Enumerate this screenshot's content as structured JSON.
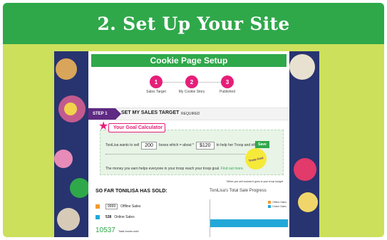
{
  "banner": {
    "title": "2. Set Up Your Site"
  },
  "cookie_page": {
    "header": "Cookie Page Setup",
    "steps": [
      {
        "number": "1",
        "label": "Sales Target"
      },
      {
        "number": "2",
        "label": "My Cookie Story"
      },
      {
        "number": "3",
        "label": "Published"
      }
    ],
    "step_bar": {
      "tag": "STEP 1",
      "title": "SET MY SALES TARGET",
      "required": "REQUIRED"
    },
    "goal_calculator": {
      "heading": "Your Goal Calculator",
      "text_before": "ToniLisa  wants to sell",
      "boxes_value": "200",
      "text_middle": "boxes which = about *",
      "amount_value": "$120",
      "text_after": "to help her Troop and others.",
      "save_label": "Save",
      "badge_text": "Troop Goal",
      "money_text": "The money you earn helps everyone in your troop reach your troop goal.",
      "find_out_more": "Find out more.",
      "note": "*When you sell cookies it goes to your troop budget."
    },
    "sold": {
      "title": "SO FAR TONILISA HAS SOLD:",
      "offline": {
        "value": "9999",
        "label": "Offline Sales"
      },
      "online": {
        "value": "538",
        "label": "Online Sales"
      },
      "total": {
        "value": "10537",
        "label": "Total boxes sold"
      }
    },
    "progress": {
      "title": "ToniLisa's Total Sale Progress",
      "legend": [
        {
          "label": "Offline Sales"
        },
        {
          "label": "Online Sales"
        }
      ]
    }
  },
  "chart_data": {
    "type": "bar",
    "title": "ToniLisa's Total Sale Progress",
    "series": [
      {
        "name": "Offline Sales",
        "values": [
          9999
        ]
      },
      {
        "name": "Online Sales",
        "values": [
          538
        ]
      }
    ]
  },
  "colors": {
    "brand_green": "#2fa84a",
    "lime_background": "#cde05c",
    "step_magenta": "#e61e79",
    "step_purple": "#5f2a83",
    "offline_orange": "#f39a2e",
    "online_blue": "#22a8d8"
  }
}
